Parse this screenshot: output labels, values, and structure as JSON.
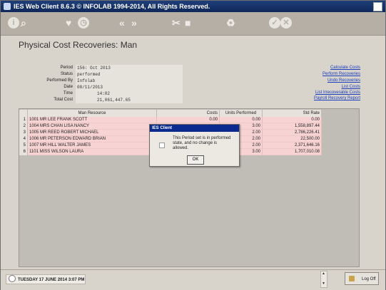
{
  "window": {
    "title": "IES Web Client 8.6.3 © INFOLAB 1994-2014, All Rights Reserved."
  },
  "toolbar": {
    "icons": [
      "info-icon",
      "search-icon",
      "heart-icon",
      "clock-icon",
      "double-left-icon",
      "double-right-icon",
      "tools-icon",
      "stop-icon",
      "recycle-icon",
      "check-icon",
      "cancel-icon"
    ]
  },
  "page": {
    "title": "Physical Cost Recoveries: Man"
  },
  "form": {
    "fields": [
      {
        "label": "Period",
        "value": "156: Oct 2013"
      },
      {
        "label": "Status",
        "value": "performed"
      },
      {
        "label": "Performed By",
        "value": "Infolab"
      },
      {
        "label": "Date",
        "value": "08/11/2013"
      },
      {
        "label": "Time",
        "value": "14:02"
      },
      {
        "label": "Total Cost",
        "value": "21,061,447.65"
      }
    ]
  },
  "links": [
    "Calculate Costs",
    "Perform Recoveries",
    "Undo Recoveries",
    "List Costs",
    "List Irrecoverable Costs",
    "Payroll Recovery Report"
  ],
  "grid": {
    "columns": [
      "Man Resource",
      "Costs",
      "Units Performed",
      "Std Rate"
    ],
    "rows": [
      {
        "num": "1",
        "resource": "1001 MR LEE FRANK SCOTT",
        "costs": "0.00",
        "units": "0.00",
        "rate": "0.00"
      },
      {
        "num": "2",
        "resource": "1004 MRS CHAN LISA NANCY",
        "costs": "",
        "units": "3.00",
        "rate": "1,558,897.44"
      },
      {
        "num": "3",
        "resource": "1005 MR REED ROBERT MICHAEL",
        "costs": "",
        "units": "2.00",
        "rate": "2,786,226.41"
      },
      {
        "num": "4",
        "resource": "1006 MR PETERSON EDWARD BRIAN",
        "costs": "",
        "units": "2.00",
        "rate": "22,500.00"
      },
      {
        "num": "5",
        "resource": "1007 MR HILL WALTER JAMES",
        "costs": "",
        "units": "2.00",
        "rate": "2,371,646.16"
      },
      {
        "num": "6",
        "resource": "1101 MISS WILSON LAURA",
        "costs": "",
        "units": "3.00",
        "rate": "1,707,010.08"
      }
    ]
  },
  "dialog": {
    "title": "IES Client",
    "message": "This Period set is in performed state, and no change is allowed.",
    "ok_label": "OK"
  },
  "status": {
    "datetime": "TUESDAY 17 JUNE 2014 3:07 PM",
    "logoff_label": "Log Off"
  }
}
